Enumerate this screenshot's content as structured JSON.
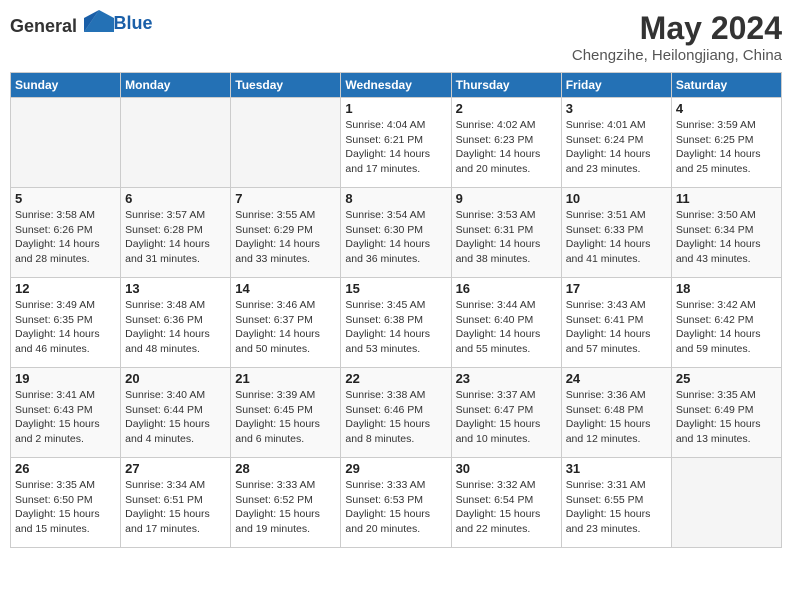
{
  "header": {
    "logo_general": "General",
    "logo_blue": "Blue",
    "title": "May 2024",
    "subtitle": "Chengzihe, Heilongjiang, China"
  },
  "days_of_week": [
    "Sunday",
    "Monday",
    "Tuesday",
    "Wednesday",
    "Thursday",
    "Friday",
    "Saturday"
  ],
  "weeks": [
    [
      {
        "day": "",
        "info": ""
      },
      {
        "day": "",
        "info": ""
      },
      {
        "day": "",
        "info": ""
      },
      {
        "day": "1",
        "info": "Sunrise: 4:04 AM\nSunset: 6:21 PM\nDaylight: 14 hours\nand 17 minutes."
      },
      {
        "day": "2",
        "info": "Sunrise: 4:02 AM\nSunset: 6:23 PM\nDaylight: 14 hours\nand 20 minutes."
      },
      {
        "day": "3",
        "info": "Sunrise: 4:01 AM\nSunset: 6:24 PM\nDaylight: 14 hours\nand 23 minutes."
      },
      {
        "day": "4",
        "info": "Sunrise: 3:59 AM\nSunset: 6:25 PM\nDaylight: 14 hours\nand 25 minutes."
      }
    ],
    [
      {
        "day": "5",
        "info": "Sunrise: 3:58 AM\nSunset: 6:26 PM\nDaylight: 14 hours\nand 28 minutes."
      },
      {
        "day": "6",
        "info": "Sunrise: 3:57 AM\nSunset: 6:28 PM\nDaylight: 14 hours\nand 31 minutes."
      },
      {
        "day": "7",
        "info": "Sunrise: 3:55 AM\nSunset: 6:29 PM\nDaylight: 14 hours\nand 33 minutes."
      },
      {
        "day": "8",
        "info": "Sunrise: 3:54 AM\nSunset: 6:30 PM\nDaylight: 14 hours\nand 36 minutes."
      },
      {
        "day": "9",
        "info": "Sunrise: 3:53 AM\nSunset: 6:31 PM\nDaylight: 14 hours\nand 38 minutes."
      },
      {
        "day": "10",
        "info": "Sunrise: 3:51 AM\nSunset: 6:33 PM\nDaylight: 14 hours\nand 41 minutes."
      },
      {
        "day": "11",
        "info": "Sunrise: 3:50 AM\nSunset: 6:34 PM\nDaylight: 14 hours\nand 43 minutes."
      }
    ],
    [
      {
        "day": "12",
        "info": "Sunrise: 3:49 AM\nSunset: 6:35 PM\nDaylight: 14 hours\nand 46 minutes."
      },
      {
        "day": "13",
        "info": "Sunrise: 3:48 AM\nSunset: 6:36 PM\nDaylight: 14 hours\nand 48 minutes."
      },
      {
        "day": "14",
        "info": "Sunrise: 3:46 AM\nSunset: 6:37 PM\nDaylight: 14 hours\nand 50 minutes."
      },
      {
        "day": "15",
        "info": "Sunrise: 3:45 AM\nSunset: 6:38 PM\nDaylight: 14 hours\nand 53 minutes."
      },
      {
        "day": "16",
        "info": "Sunrise: 3:44 AM\nSunset: 6:40 PM\nDaylight: 14 hours\nand 55 minutes."
      },
      {
        "day": "17",
        "info": "Sunrise: 3:43 AM\nSunset: 6:41 PM\nDaylight: 14 hours\nand 57 minutes."
      },
      {
        "day": "18",
        "info": "Sunrise: 3:42 AM\nSunset: 6:42 PM\nDaylight: 14 hours\nand 59 minutes."
      }
    ],
    [
      {
        "day": "19",
        "info": "Sunrise: 3:41 AM\nSunset: 6:43 PM\nDaylight: 15 hours\nand 2 minutes."
      },
      {
        "day": "20",
        "info": "Sunrise: 3:40 AM\nSunset: 6:44 PM\nDaylight: 15 hours\nand 4 minutes."
      },
      {
        "day": "21",
        "info": "Sunrise: 3:39 AM\nSunset: 6:45 PM\nDaylight: 15 hours\nand 6 minutes."
      },
      {
        "day": "22",
        "info": "Sunrise: 3:38 AM\nSunset: 6:46 PM\nDaylight: 15 hours\nand 8 minutes."
      },
      {
        "day": "23",
        "info": "Sunrise: 3:37 AM\nSunset: 6:47 PM\nDaylight: 15 hours\nand 10 minutes."
      },
      {
        "day": "24",
        "info": "Sunrise: 3:36 AM\nSunset: 6:48 PM\nDaylight: 15 hours\nand 12 minutes."
      },
      {
        "day": "25",
        "info": "Sunrise: 3:35 AM\nSunset: 6:49 PM\nDaylight: 15 hours\nand 13 minutes."
      }
    ],
    [
      {
        "day": "26",
        "info": "Sunrise: 3:35 AM\nSunset: 6:50 PM\nDaylight: 15 hours\nand 15 minutes."
      },
      {
        "day": "27",
        "info": "Sunrise: 3:34 AM\nSunset: 6:51 PM\nDaylight: 15 hours\nand 17 minutes."
      },
      {
        "day": "28",
        "info": "Sunrise: 3:33 AM\nSunset: 6:52 PM\nDaylight: 15 hours\nand 19 minutes."
      },
      {
        "day": "29",
        "info": "Sunrise: 3:33 AM\nSunset: 6:53 PM\nDaylight: 15 hours\nand 20 minutes."
      },
      {
        "day": "30",
        "info": "Sunrise: 3:32 AM\nSunset: 6:54 PM\nDaylight: 15 hours\nand 22 minutes."
      },
      {
        "day": "31",
        "info": "Sunrise: 3:31 AM\nSunset: 6:55 PM\nDaylight: 15 hours\nand 23 minutes."
      },
      {
        "day": "",
        "info": ""
      }
    ]
  ]
}
